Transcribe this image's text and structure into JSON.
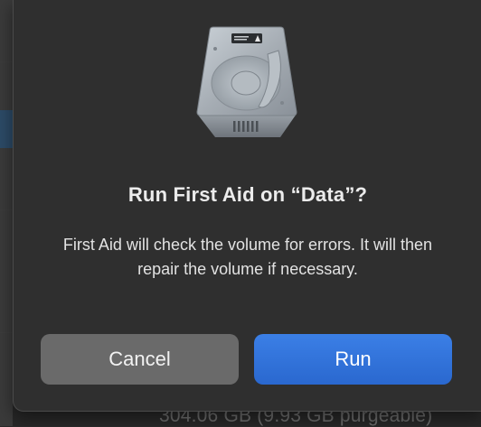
{
  "dialog": {
    "title": "Run First Aid on “Data”?",
    "message": "First Aid will check the volume for errors. It will then repair the volume if necessary.",
    "icon": "internal-disk-icon",
    "buttons": {
      "cancel_label": "Cancel",
      "run_label": "Run"
    },
    "colors": {
      "primary_button": "#2f72d9",
      "secondary_button": "#6a6a6a",
      "dialog_background": "#2f2f2f"
    }
  },
  "background": {
    "volume_capacity_text": "304.06 GB (9.93 GB purgeable)"
  }
}
